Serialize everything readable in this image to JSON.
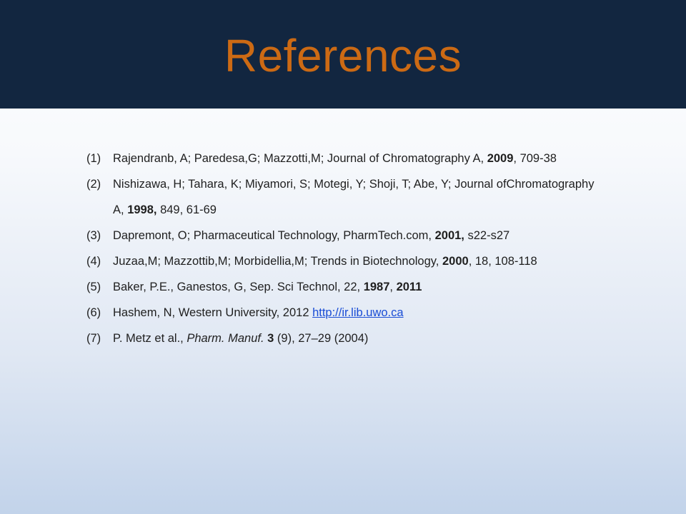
{
  "slide": {
    "title": "References"
  },
  "references": [
    {
      "num": "(1)",
      "parts": [
        {
          "t": "Rajendranb, A; Paredesa,G; Mazzotti,M; Journal of Chromatography A, "
        },
        {
          "t": "2009",
          "s": "b"
        },
        {
          "t": ", 709-38"
        }
      ]
    },
    {
      "num": "(2)",
      "parts": [
        {
          "t": "Nishizawa, H; Tahara, K; Miyamori, S; Motegi, Y; Shoji, T; Abe, Y; Journal ofChromatography A, "
        },
        {
          "t": "1998,",
          "s": "b"
        },
        {
          "t": " 849, 61-69"
        }
      ]
    },
    {
      "num": "(3)",
      "parts": [
        {
          "t": "Dapremont, O; Pharmaceutical Technology, PharmTech.com, "
        },
        {
          "t": "2001,",
          "s": "b"
        },
        {
          "t": " s22-s27"
        }
      ]
    },
    {
      "num": "(4)",
      "parts": [
        {
          "t": "Juzaa,M; Mazzottib,M; Morbidellia,M; Trends in Biotechnology, "
        },
        {
          "t": "2000",
          "s": "b"
        },
        {
          "t": ", 18, 108-118"
        }
      ]
    },
    {
      "num": "(5)",
      "parts": [
        {
          "t": "Baker, P.E., Ganestos, G, Sep. Sci Technol, 22, "
        },
        {
          "t": "1987",
          "s": "b"
        },
        {
          "t": ", "
        },
        {
          "t": "2011",
          "s": "b"
        }
      ]
    },
    {
      "num": "(6)",
      "parts": [
        {
          "t": "Hashem, N, Western University, 2012 "
        },
        {
          "t": "http://ir.lib.uwo.ca",
          "s": "link"
        }
      ]
    },
    {
      "num": "(7)",
      "parts": [
        {
          "t": "P. Metz et al., "
        },
        {
          "t": "Pharm. Manuf.",
          "s": "i"
        },
        {
          "t": " "
        },
        {
          "t": "3",
          "s": "b"
        },
        {
          "t": " (9), 27–29 (2004)"
        }
      ]
    }
  ],
  "colors": {
    "header_bg": "#122640",
    "title": "#cc6a14",
    "link": "#1a4dd6"
  }
}
